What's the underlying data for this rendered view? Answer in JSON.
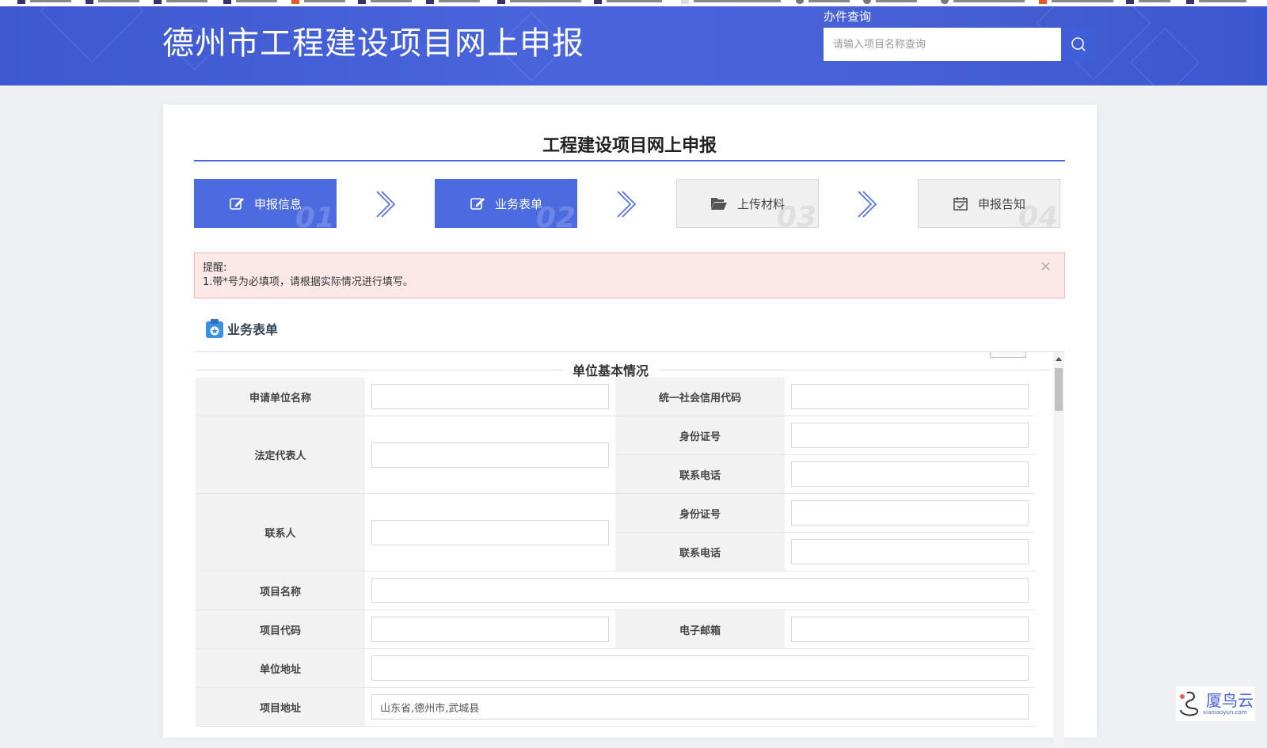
{
  "header": {
    "title": "德州市工程建设项目网上申报",
    "search_label": "办件查询",
    "search_placeholder": "请输入项目名称查询"
  },
  "card": {
    "title": "工程建设项目网上申报"
  },
  "steps": [
    {
      "label": "申报信息",
      "number": "01",
      "state": "active"
    },
    {
      "label": "业务表单",
      "number": "02",
      "state": "active"
    },
    {
      "label": "上传材料",
      "number": "03",
      "state": "idle"
    },
    {
      "label": "申报告知",
      "number": "04",
      "state": "idle"
    }
  ],
  "reminder": {
    "title": "提醒:",
    "text": "1.带*号为必填项，请根据实际情况进行填写。",
    "close": "×"
  },
  "section": {
    "title": "业务表单",
    "legend": "单位基本情况"
  },
  "form": {
    "applicant_name_label": "申请单位名称",
    "credit_code_label": "统一社会信用代码",
    "legal_rep_label": "法定代表人",
    "legal_id_label": "身份证号",
    "legal_phone_label": "联系电话",
    "contact_label": "联系人",
    "contact_id_label": "身份证号",
    "contact_phone_label": "联系电话",
    "project_name_label": "项目名称",
    "project_code_label": "项目代码",
    "email_label": "电子邮箱",
    "unit_address_label": "单位地址",
    "project_address_label": "项目地址",
    "project_address_value": "山东省,德州市,武城县"
  },
  "watermark": {
    "text": "厦鸟云",
    "sub": "xianiaoyun.com"
  },
  "colors": {
    "primary": "#4d6be0",
    "banner": "#4760d6",
    "reminder_bg": "#fde8e8"
  }
}
